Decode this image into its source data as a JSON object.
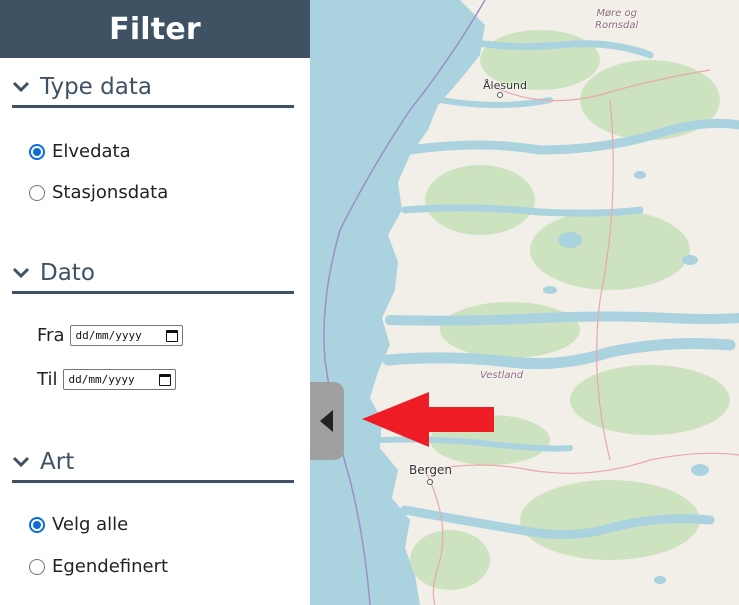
{
  "sidebar": {
    "title": "Filter",
    "sections": {
      "type_data": {
        "title": "Type data",
        "options": [
          "Elvedata",
          "Stasjonsdata"
        ],
        "selected": "Elvedata"
      },
      "dato": {
        "title": "Dato",
        "from_label": "Fra",
        "to_label": "Til",
        "from_value": "dd/mm/yyyy",
        "to_value": "dd/mm/yyyy"
      },
      "art": {
        "title": "Art",
        "options": [
          "Velg alle",
          "Egendefinert"
        ],
        "selected": "Velg alle"
      }
    }
  },
  "map": {
    "labels": {
      "more_og_romsdal_1": "Møre og",
      "more_og_romsdal_2": "Romsdal",
      "alesund": "Ålesund",
      "vestland": "Vestland",
      "bergen": "Bergen"
    }
  },
  "colors": {
    "sidebar_header": "#3f5264",
    "section_rule": "#3f5264",
    "radio_checked": "#0b6cd9",
    "sea": "#aad3df",
    "land": "#f2efe9",
    "forest": "#cde3c0",
    "arrow": "#ee1c25",
    "toggle_tab": "#a0a0a0"
  },
  "icons": [
    "chevron-down-icon",
    "calendar-icon",
    "collapse-left-icon",
    "red-arrow-left"
  ]
}
